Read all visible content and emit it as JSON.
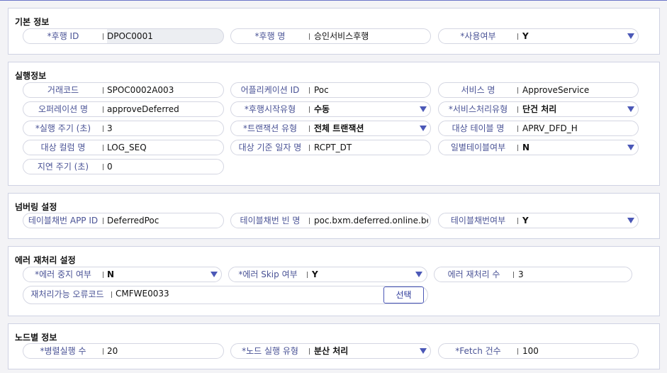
{
  "sections": {
    "basic": {
      "title": "기본 정보",
      "route_id": {
        "label": "*후행 ID",
        "value": "DPOC0001"
      },
      "route_name": {
        "label": "*후행 명",
        "value": "승인서비스후행"
      },
      "use_yn": {
        "label": "*사용여부",
        "value": "Y"
      }
    },
    "exec": {
      "title": "실행정보",
      "trx_code": {
        "label": "거래코드",
        "value": "SPOC0002A003"
      },
      "app_id": {
        "label": "어플리케이션 ID",
        "value": "Poc"
      },
      "service_name": {
        "label": "서비스 명",
        "value": "ApproveService"
      },
      "operation_name": {
        "label": "오퍼레이션 명",
        "value": "approveDeferred"
      },
      "start_type": {
        "label": "*후행시작유형",
        "value": "수동"
      },
      "service_proc_type": {
        "label": "*서비스처리유형",
        "value": "단건 처리"
      },
      "exec_cycle": {
        "label": "*실행 주기 (초)",
        "value": "3"
      },
      "trx_type": {
        "label": "*트랜잭션 유형",
        "value": "전체 트랜잭션"
      },
      "target_table": {
        "label": "대상 테이블 명",
        "value": "APRV_DFD_H"
      },
      "target_column": {
        "label": "대상 컬럼 명",
        "value": "LOG_SEQ"
      },
      "base_date_column": {
        "label": "대상 기준 일자 명",
        "value": "RCPT_DT"
      },
      "daily_table_yn": {
        "label": "일별테이블여부",
        "value": "N"
      },
      "delay_cycle": {
        "label": "지연 주기 (초)",
        "value": "0"
      }
    },
    "numbering": {
      "title": "넘버링 설정",
      "app_id": {
        "label": "테이블채번 APP ID",
        "value": "DeferredPoc"
      },
      "bean_name": {
        "label": "테이블채번 빈 명",
        "value": "poc.bxm.deferred.online.bean"
      },
      "numbering_yn": {
        "label": "테이블채번여부",
        "value": "Y"
      }
    },
    "error": {
      "title": "에러 재처리 설정",
      "stop_on_error": {
        "label": "*에러 중지 여부",
        "value": "N"
      },
      "skip_yn": {
        "label": "*에러 Skip 여부",
        "value": "Y"
      },
      "retry_count": {
        "label": "에러 재처리 수",
        "value": "3"
      },
      "retry_error_codes": {
        "label": "재처리가능 오류코드",
        "value": "CMFWE0033"
      },
      "select_button": "선택"
    },
    "node": {
      "title": "노드별 정보",
      "parallel_count": {
        "label": "*병렬실행 수",
        "value": "20"
      },
      "node_exec_type": {
        "label": "*노드 실행 유형",
        "value": "분산 처리"
      },
      "fetch_count": {
        "label": "*Fetch 건수",
        "value": "100"
      }
    }
  }
}
